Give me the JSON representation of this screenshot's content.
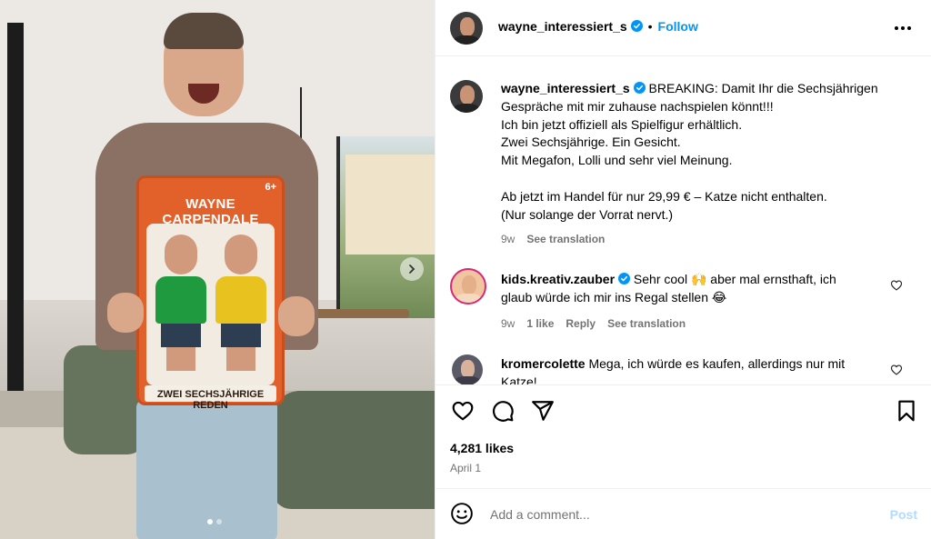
{
  "post": {
    "image": {
      "toy_title": "WAYNE CARPENDALE",
      "toy_age": "6+",
      "toy_subtitle": "ZWEI SECHSJÄHRIGE REDEN",
      "carousel_count": 2,
      "carousel_active": 1
    },
    "header": {
      "username": "wayne_interessiert_s",
      "separator": "•",
      "follow_label": "Follow",
      "more_icon": "more-horizontal-icon"
    },
    "caption": {
      "username": "wayne_interessiert_s",
      "lines": [
        "BREAKING: Damit Ihr die Sechsjährigen",
        "Gespräche mit mir zuhause nachspielen könnt!!!",
        "Ich bin jetzt offiziell als Spielfigur erhältlich.",
        "Zwei Sechsjährige. Ein Gesicht.",
        "Mit Megafon, Lolli und sehr viel Meinung.",
        "",
        "Ab jetzt im Handel für nur 29,99 € – Katze nicht enthalten.",
        "(Nur solange der Vorrat nervt.)"
      ],
      "age": "9w",
      "see_translation": "See translation"
    },
    "comments": [
      {
        "username": "kids.kreativ.zauber",
        "verified": true,
        "text_line1": "Sehr cool 🙌 aber mal ernsthaft, ich",
        "text_line2": "glaub würde ich mir ins Regal stellen 😂",
        "age": "9w",
        "likes": "1 like",
        "reply": "Reply",
        "see_translation": "See translation"
      },
      {
        "username": "kromercolette",
        "verified": false,
        "text_line1": "Mega, ich würde es kaufen, allerdings nur mit",
        "text_line2": "Katze!"
      }
    ],
    "actions": {
      "like_icon": "heart-icon",
      "comment_icon": "comment-icon",
      "share_icon": "send-icon",
      "save_icon": "bookmark-icon",
      "likes": "4,281 likes",
      "date": "April 1"
    },
    "add_comment": {
      "emoji_icon": "emoji-icon",
      "placeholder": "Add a comment...",
      "post_label": "Post"
    },
    "colors": {
      "accent": "#0095f6",
      "post_disabled": "#b3dbff",
      "muted": "#737373",
      "toy_box": "#e2612a"
    }
  }
}
